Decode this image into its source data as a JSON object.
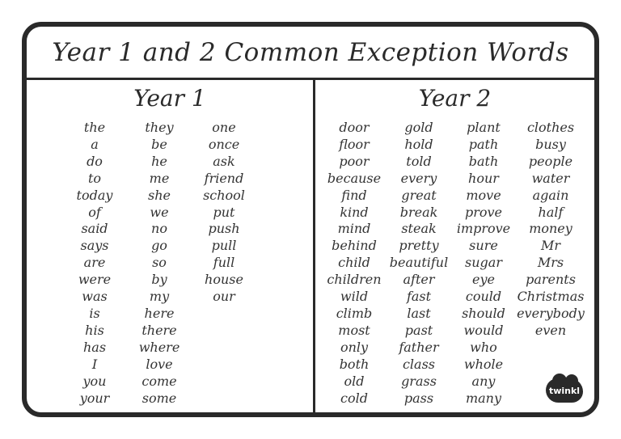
{
  "title": "Year 1 and 2 Common Exception Words",
  "year1": {
    "heading": "Year 1",
    "columns": [
      [
        "the",
        "a",
        "do",
        "to",
        "today",
        "of",
        "said",
        "says",
        "are",
        "were",
        "was",
        "is",
        "his",
        "has",
        "I",
        "you",
        "your"
      ],
      [
        "they",
        "be",
        "he",
        "me",
        "she",
        "we",
        "no",
        "go",
        "so",
        "by",
        "my",
        "here",
        "there",
        "where",
        "love",
        "come",
        "some"
      ],
      [
        "one",
        "once",
        "ask",
        "friend",
        "school",
        "put",
        "push",
        "pull",
        "full",
        "house",
        "our"
      ]
    ]
  },
  "year2": {
    "heading": "Year 2",
    "columns": [
      [
        "door",
        "floor",
        "poor",
        "because",
        "find",
        "kind",
        "mind",
        "behind",
        "child",
        "children",
        "wild",
        "climb",
        "most",
        "only",
        "both",
        "old",
        "cold"
      ],
      [
        "gold",
        "hold",
        "told",
        "every",
        "great",
        "break",
        "steak",
        "pretty",
        "beautiful",
        "after",
        "fast",
        "last",
        "past",
        "father",
        "class",
        "grass",
        "pass"
      ],
      [
        "plant",
        "path",
        "bath",
        "hour",
        "move",
        "prove",
        "improve",
        "sure",
        "sugar",
        "eye",
        "could",
        "should",
        "would",
        "who",
        "whole",
        "any",
        "many"
      ],
      [
        "clothes",
        "busy",
        "people",
        "water",
        "again",
        "half",
        "money",
        "Mr",
        "Mrs",
        "parents",
        "Christmas",
        "everybody",
        "even"
      ]
    ]
  },
  "logo": {
    "text": "twinkl",
    "icon": "twinkl-cloud-logo"
  },
  "colors": {
    "border": "#2a2a2a",
    "text": "#333333",
    "background": "#ffffff"
  }
}
